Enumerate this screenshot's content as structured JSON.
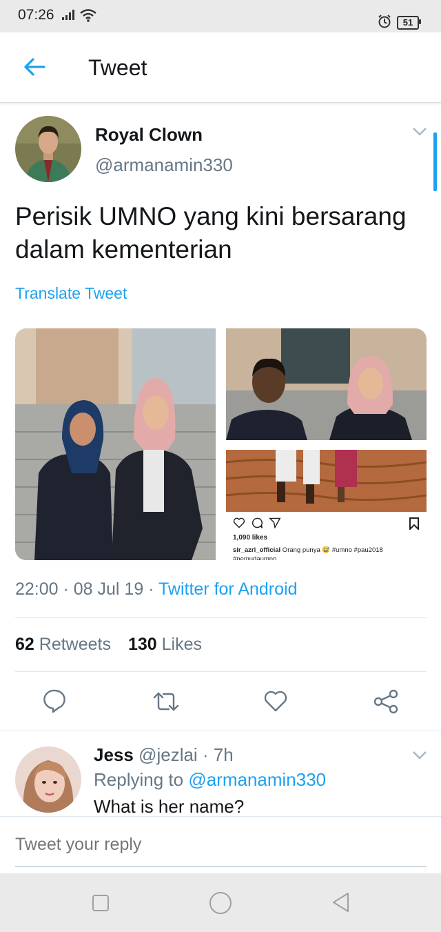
{
  "status_bar": {
    "time": "07:26",
    "battery": "51"
  },
  "header": {
    "title": "Tweet"
  },
  "tweet": {
    "display_name": "Royal Clown",
    "handle": "@armanamin330",
    "text": "Perisik UMNO yang kini bersarang dalam kementerian",
    "translate_label": "Translate Tweet",
    "timestamp": "22:00 · 08 Jul 19 · ",
    "source": "Twitter for Android",
    "retweets_count": "62",
    "retweets_label": "Retweets",
    "likes_count": "130",
    "likes_label": "Likes",
    "embedded_post": {
      "likes": "1,090 likes",
      "username": "sir_azri_official",
      "caption": " Orang punya 😅 #umno #pau2018",
      "caption_more": "#pemudaumno"
    }
  },
  "reply": {
    "name": "Jess",
    "handle_time": " @jezlai · 7h",
    "replying_prefix": "Replying to ",
    "replying_to": "@armanamin330",
    "text": "What is her name?"
  },
  "compose": {
    "placeholder": "Tweet your reply"
  },
  "colors": {
    "accent": "#1da1f2",
    "secondary_text": "#657786",
    "primary_text": "#14171a"
  }
}
